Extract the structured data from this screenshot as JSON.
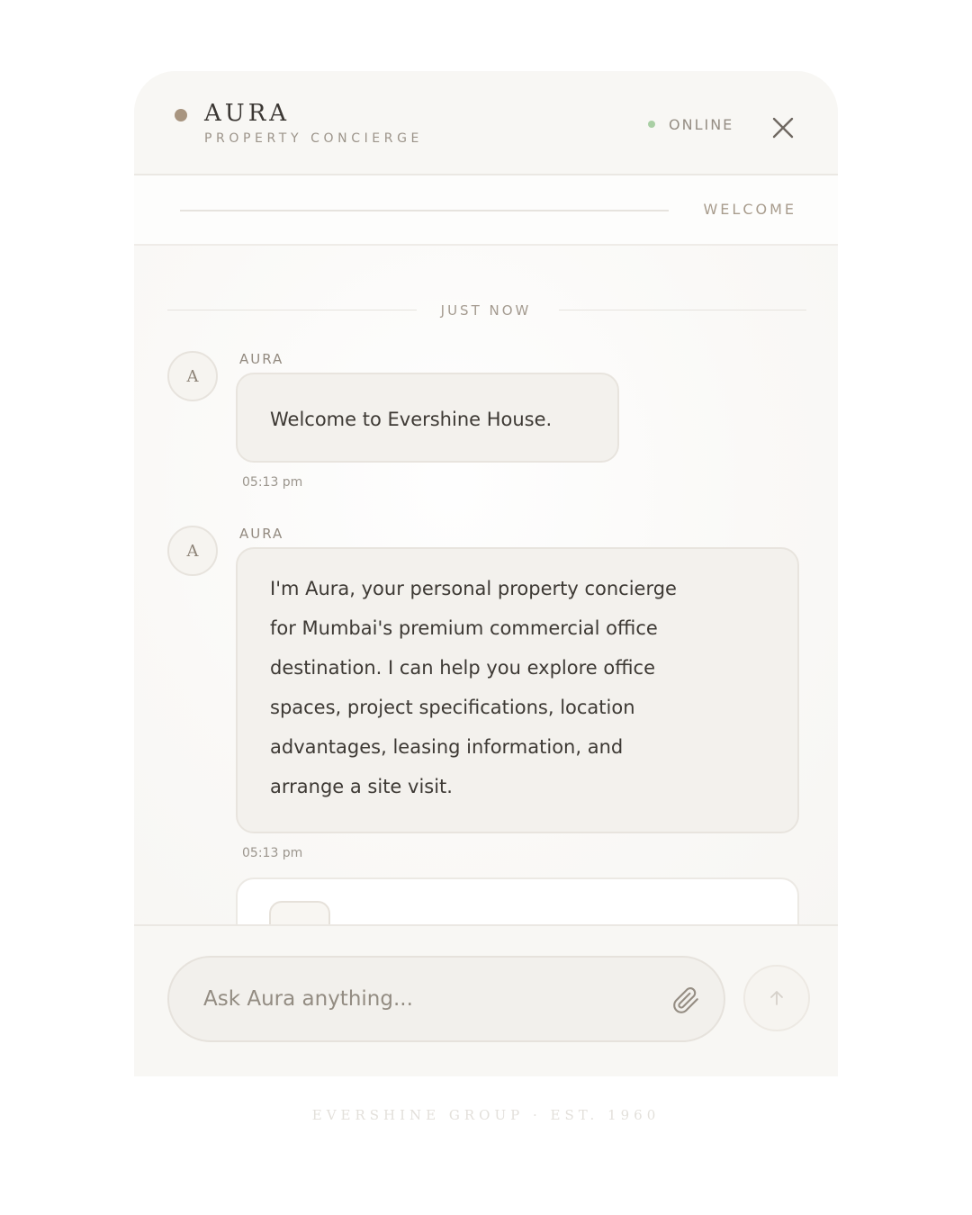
{
  "header": {
    "brand_name": "AURA",
    "brand_subtitle": "PROPERTY CONCIERGE",
    "status": "ONLINE",
    "status_color": "#a9cfa4",
    "accent_color": "#a89580",
    "close_icon": "close-icon"
  },
  "band": {
    "label": "WELCOME"
  },
  "conversation": {
    "divider_label": "JUST NOW",
    "messages": [
      {
        "avatar": "A",
        "sender": "AURA",
        "lines": [
          "Welcome to Evershine House."
        ],
        "time": "05:13 pm"
      },
      {
        "avatar": "A",
        "sender": "AURA",
        "lines": [
          "I'm Aura, your personal property concierge",
          "for Mumbai's premium commercial office",
          "destination. I can help you explore office",
          "spaces, project specifications, location",
          "advantages, leasing information, and",
          "arrange a site visit."
        ],
        "time": "05:13 pm"
      }
    ]
  },
  "composer": {
    "placeholder": "Ask Aura anything...",
    "value": "",
    "attach_icon": "paperclip-icon",
    "send_icon": "arrow-up-icon"
  },
  "footer": {
    "text": "EVERSHINE GROUP · EST. 1960"
  }
}
